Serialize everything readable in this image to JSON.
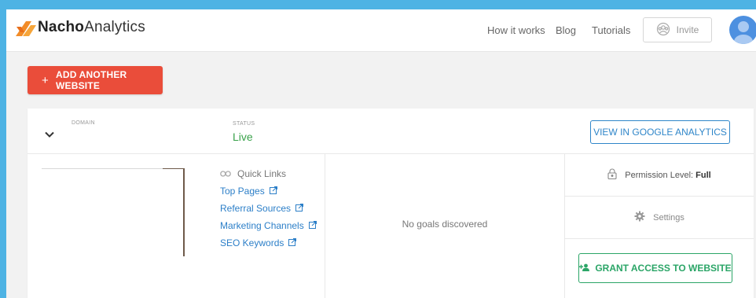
{
  "brand": {
    "name_bold": "Nacho",
    "name_rest": "Analytics"
  },
  "nav": {
    "links": [
      "How it works",
      "Blog",
      "Tutorials"
    ],
    "invite_label": "Invite"
  },
  "actions": {
    "add_website_label": "ADD ANOTHER WEBSITE"
  },
  "site_card": {
    "domain_label": "DOMAIN",
    "status_label": "STATUS",
    "status_value": "Live",
    "view_ga_label": "VIEW IN GOOGLE ANALYTICS",
    "quick_links_title": "Quick Links",
    "quick_links": [
      "Top Pages",
      "Referral Sources",
      "Marketing Channels",
      "SEO Keywords"
    ],
    "goals_text": "No goals discovered",
    "permission_label": "Permission Level:",
    "permission_value": "Full",
    "settings_label": "Settings",
    "grant_label": "GRANT ACCESS TO WEBSITE"
  },
  "colors": {
    "accent_blue": "#2f86c9",
    "brand_red": "#ea4d3a",
    "status_green": "#3aa24b",
    "grant_green": "#2ba567",
    "logo_orange": "#f28c28"
  },
  "icons": [
    "logo-icon",
    "invite-icon",
    "avatar",
    "chevron-down-icon",
    "link-icon",
    "external-link-icon",
    "lock-icon",
    "gear-icon",
    "add-user-icon"
  ]
}
